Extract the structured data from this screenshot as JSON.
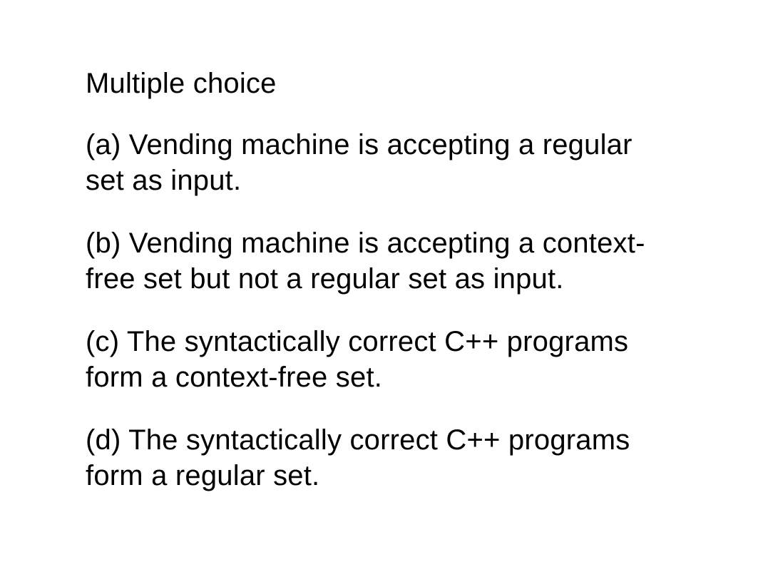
{
  "heading": "Multiple choice",
  "options": {
    "a": "(a) Vending machine is accepting a regular set as input.",
    "b": "(b) Vending machine is accepting a context-free set but not a regular set as input.",
    "c": "(c) The syntactically correct C++ programs form a context-free set.",
    "d": "(d) The syntactically correct C++ programs form a regular set."
  }
}
